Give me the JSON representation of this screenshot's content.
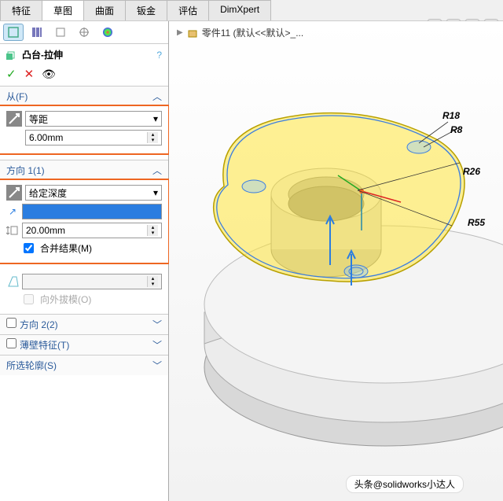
{
  "tabs": [
    "特征",
    "草图",
    "曲面",
    "钣金",
    "评估",
    "DimXpert"
  ],
  "active_tab": 1,
  "breadcrumb": {
    "icon": "part-icon",
    "text": "零件11  (默认<<默认>_..."
  },
  "feature": {
    "icon": "extrude-icon",
    "title": "凸台-拉伸"
  },
  "actions": {
    "ok": "✓",
    "cancel": "✕",
    "preview": "👁"
  },
  "sections": {
    "from": {
      "title": "从(F)",
      "combo": "等距",
      "value": "6.00mm"
    },
    "dir1": {
      "title": "方向 1(1)",
      "combo": "给定深度",
      "depth_value": "20.00mm",
      "merge": "合并结果(M)",
      "draft": "向外拔模(O)",
      "draft_checked": false
    },
    "dir2": {
      "title": "方向 2(2)",
      "checked": false
    },
    "thin": {
      "title": "薄壁特征(T)",
      "checked": false
    },
    "contour": {
      "title": "所选轮廓(S)"
    }
  },
  "chevron": "︿",
  "dims": {
    "r18": "R18",
    "r8": "R8",
    "r26": "R26",
    "r55": "R55"
  },
  "watermark": "头条@solidworks小达人"
}
